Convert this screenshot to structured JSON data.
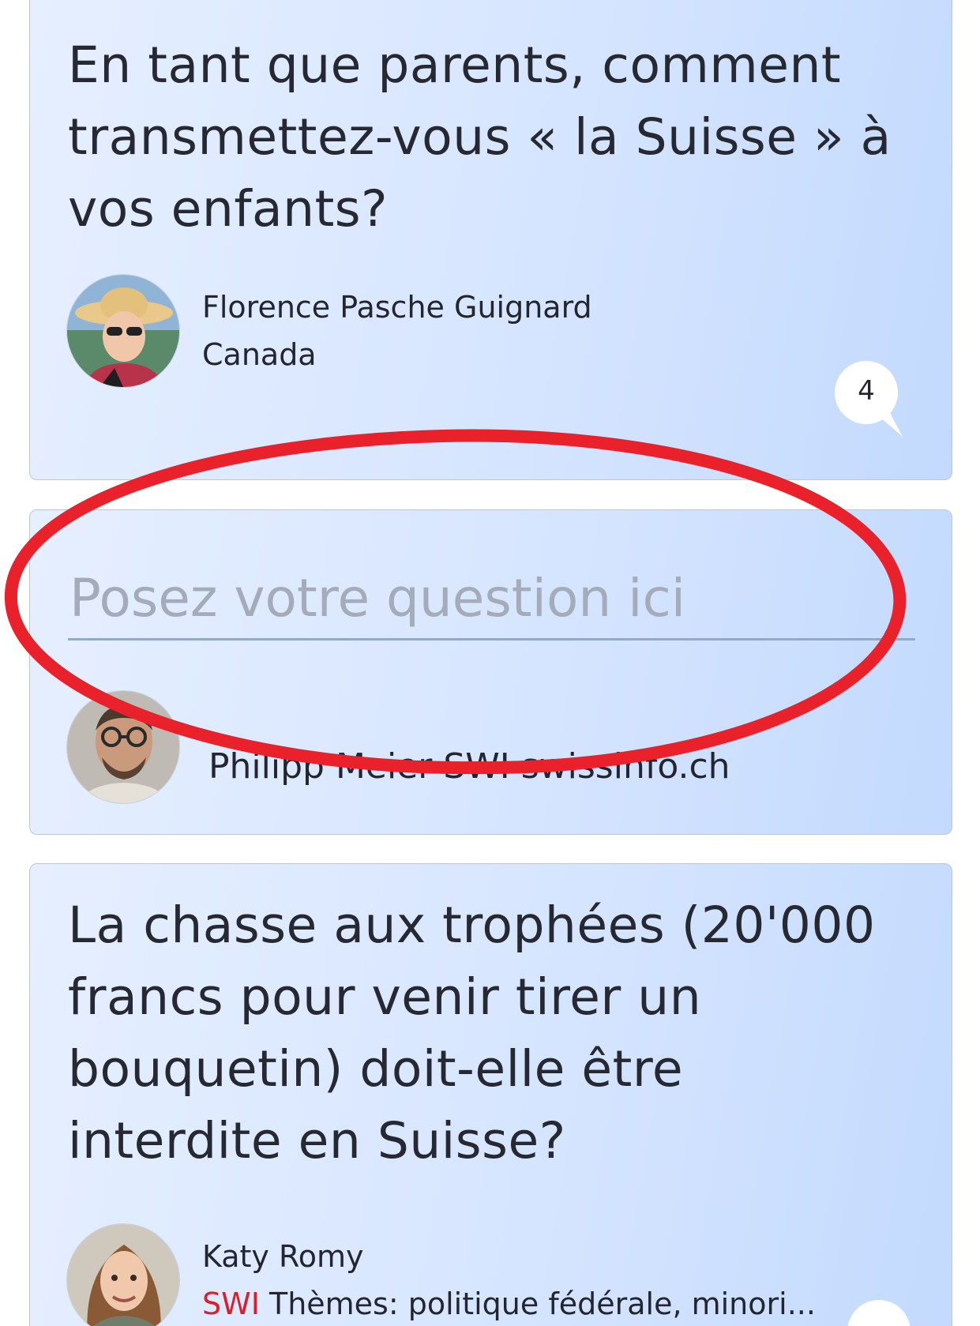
{
  "cards": [
    {
      "title": "En tant que parents, comment transmettez-vous « la Suisse » à vos enfants?",
      "author_name": "Florence Pasche Guignard",
      "author_location": "Canada",
      "comment_count": "4"
    },
    {
      "title": "La chasse aux trophées (20'000 francs pour venir tirer un bouquetin) doit-elle être interdite en Suisse?",
      "author_name": "Katy Romy",
      "author_org": "SWI",
      "author_desc": " Thèmes: politique fédérale, minori..."
    }
  ],
  "ask": {
    "placeholder": "Posez votre question ici",
    "author_name": "Philipp Meier SWI swissinfo.ch"
  },
  "colors": {
    "card_gradient_start": "#e6efff",
    "card_gradient_end": "#c3dafe",
    "annotation_red": "#e8212b",
    "org_red": "#d8202d"
  }
}
